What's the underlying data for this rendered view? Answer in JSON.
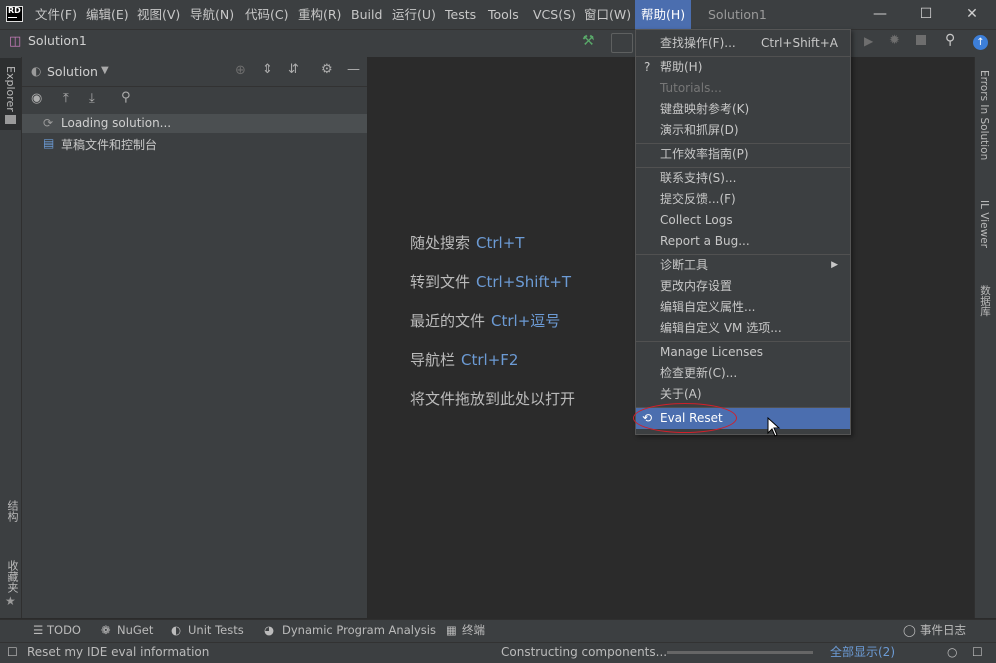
{
  "menubar": {
    "items": [
      "文件(F)",
      "编辑(E)",
      "视图(V)",
      "导航(N)",
      "代码(C)",
      "重构(R)",
      "Build",
      "运行(U)",
      "Tests",
      "Tools",
      "VCS(S)",
      "窗口(W)",
      "帮助(H)"
    ],
    "window_title": "Solution1"
  },
  "navbar": {
    "breadcrumb": "Solution1"
  },
  "left_strip": {
    "explorer": "Explorer",
    "structure": "结构",
    "favorites": "收藏夹"
  },
  "right_strip": {
    "errors": "Errors In Solution",
    "il_viewer": "IL Viewer",
    "database": "数据库"
  },
  "explorer": {
    "title": "Solution",
    "tree": [
      "Loading solution...",
      "草稿文件和控制台"
    ]
  },
  "editor_hints": [
    {
      "label": "随处搜索",
      "shortcut": "Ctrl+T"
    },
    {
      "label": "转到文件",
      "shortcut": "Ctrl+Shift+T"
    },
    {
      "label": "最近的文件",
      "shortcut": "Ctrl+逗号"
    },
    {
      "label": "导航栏",
      "shortcut": "Ctrl+F2"
    },
    {
      "label": "将文件拖放到此处以打开",
      "shortcut": ""
    }
  ],
  "help_menu": {
    "find_action": "查找操作(F)...",
    "find_action_shortcut": "Ctrl+Shift+A",
    "help": "帮助(H)",
    "tutorials": "Tutorials...",
    "keymap": "键盘映射参考(K)",
    "demos": "演示和抓屏(D)",
    "productivity": "工作效率指南(P)",
    "support": "联系支持(S)...",
    "feedback": "提交反馈...(F)",
    "collect_logs": "Collect Logs",
    "report_bug": "Report a Bug...",
    "diagnostic": "诊断工具",
    "memory": "更改内存设置",
    "custom_props": "编辑自定义属性...",
    "custom_vm": "编辑自定义 VM 选项...",
    "licenses": "Manage Licenses",
    "check_updates": "检查更新(C)...",
    "about": "关于(A)",
    "eval_reset": "Eval Reset"
  },
  "bottom_tools": [
    "TODO",
    "NuGet",
    "Unit Tests",
    "Dynamic Program Analysis",
    "终端",
    "事件日志"
  ],
  "status": {
    "left": "Reset my IDE eval information",
    "progress_text": "Constructing components...",
    "show_all": "全部显示(2)"
  },
  "colors": {
    "accent": "#4b6eaf",
    "shortcut": "#6c9bd5",
    "annotation": "#d0202a"
  }
}
